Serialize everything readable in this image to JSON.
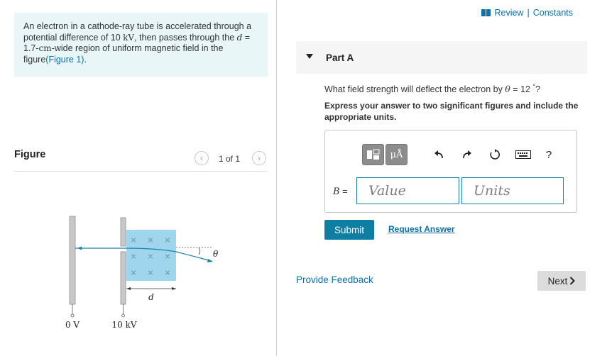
{
  "problem": {
    "text_before": "An electron in a cathode-ray tube is accelerated through a potential difference of 10 ",
    "unit_kv": "kV",
    "text_middle": ", then passes through the ",
    "d_symbol": "d",
    "d_value": " = 1.7-",
    "d_unit": "cm",
    "text_after": "-wide region of uniform magnetic field in the figure",
    "figure_link": "(Figure 1)",
    "period": "."
  },
  "figure": {
    "title": "Figure",
    "pager_text": "1 of 1",
    "prev_icon": "chevron-left-icon",
    "next_icon": "chevron-right-icon",
    "diagram": {
      "label_left_plate": "0 V",
      "label_right_plate": "10 kV",
      "label_width": "d",
      "label_angle": "θ",
      "field_symbol": "×"
    }
  },
  "header": {
    "review_label": "Review",
    "separator": "|",
    "constants_label": "Constants",
    "review_icon": "book-icon"
  },
  "part": {
    "label": "Part A",
    "question_before": "What field strength will deflect the electron by ",
    "theta": "θ",
    "question_value": " = 12 ",
    "degree": "°",
    "question_end": "?",
    "instructions": "Express your answer to two significant figures and include the appropriate units."
  },
  "toolbar": {
    "templates_icon": "templates-icon",
    "units_label": "μÅ",
    "undo_icon": "undo-icon",
    "redo_icon": "redo-icon",
    "reset_icon": "reset-icon",
    "keyboard_icon": "keyboard-icon",
    "help_label": "?"
  },
  "answer": {
    "variable": "B",
    "equals": " =",
    "value_placeholder": "Value",
    "units_placeholder": "Units"
  },
  "actions": {
    "submit_label": "Submit",
    "request_label": "Request Answer",
    "feedback_label": "Provide Feedback",
    "next_label": "Next",
    "next_icon": "chevron-right-icon"
  }
}
